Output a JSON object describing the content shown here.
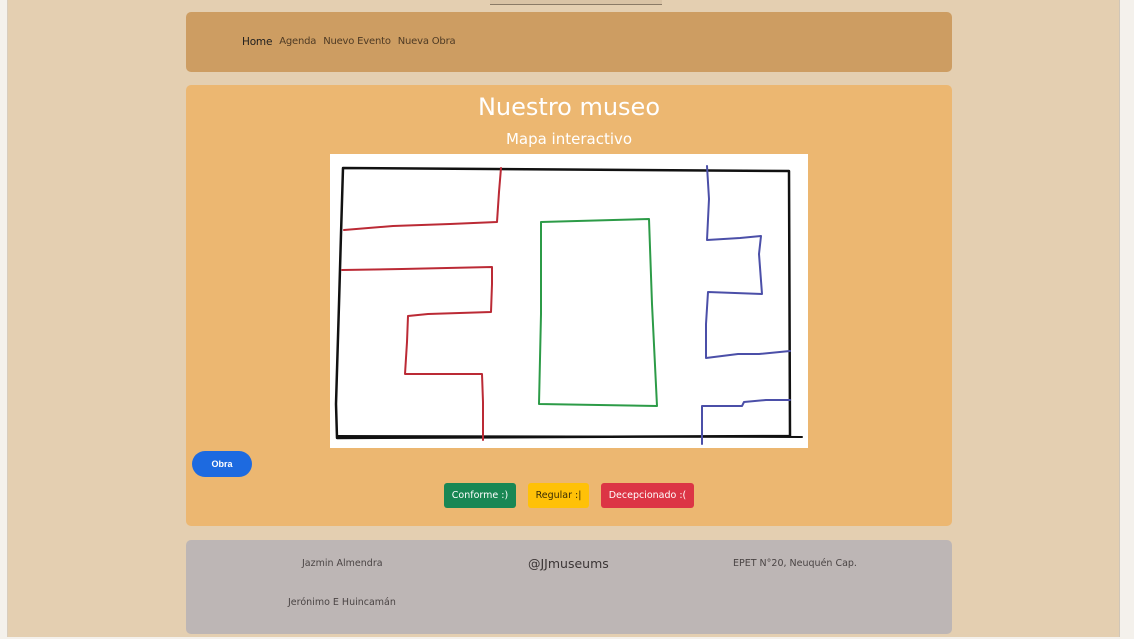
{
  "nav": {
    "items": [
      "Home",
      "Agenda",
      "Nuevo Evento",
      "Nueva Obra"
    ]
  },
  "main": {
    "title": "Nuestro museo",
    "subtitle": "Mapa interactivo",
    "obra_button": "Obra",
    "ratings": {
      "ok": "Conforme :)",
      "mid": "Regular :|",
      "bad": "Decepcionado :("
    }
  },
  "footer": {
    "author1": "Jazmin Almendra",
    "author2": "Jerónimo E Huincamán",
    "handle": "@JJmuseums",
    "school": "EPET N°20, Neuquén Cap."
  },
  "colors": {
    "background": "#e4cfb1",
    "navbar": "#cd9d62",
    "main_panel": "#ecb771",
    "footer": "#bdb6b5",
    "obra_button": "#1d6ae0",
    "conforme": "#198754",
    "regular": "#ffc107",
    "decepcionado": "#dc3545"
  }
}
